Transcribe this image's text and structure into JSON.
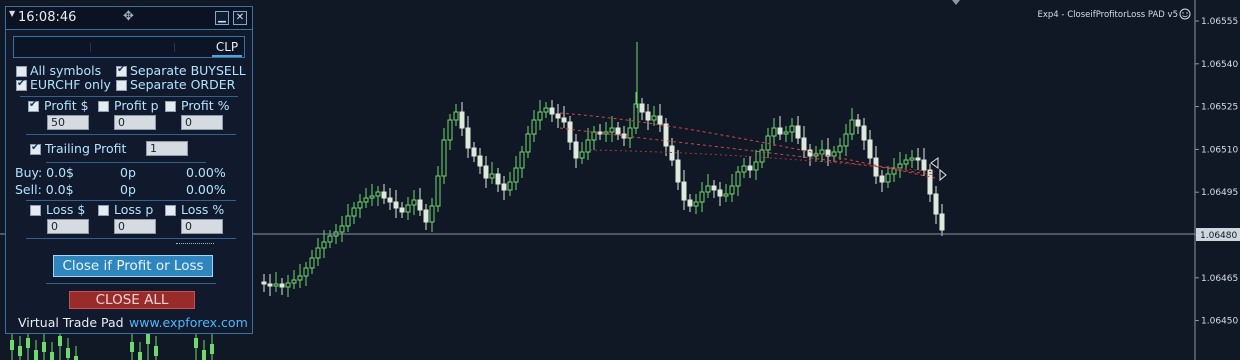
{
  "chart": {
    "title": "Exp4 - CloseifProfitorLoss PAD v5",
    "title_icon": "smiley-icon",
    "price_labels": [
      "1.06555",
      "1.06540",
      "1.06525",
      "1.06510",
      "1.06495",
      "1.06480",
      "1.06465",
      "1.06450"
    ],
    "current_price": "1.06480",
    "bull_color": "#6fd86f",
    "bear_color": "#dfe8dc",
    "background": "#101725"
  },
  "panel": {
    "time": "16:08:46",
    "move_icon": "move-icon",
    "minimize_icon": "minimize-icon",
    "close_icon": "close-icon",
    "tab_clp": "CLP",
    "all_symbols": "All symbols",
    "separate_buysell": "Separate BUYSELL",
    "eurchf_only": "EURCHF only",
    "separate_order": "Separate ORDER",
    "profit_usd": "Profit $",
    "profit_p": "Profit p",
    "profit_pct": "Profit %",
    "profit_usd_value": "50",
    "profit_p_value": "0",
    "profit_pct_value": "0",
    "trailing_profit": "Trailing Profit",
    "trailing_value": "1",
    "buy_label": "Buy: 0.0$",
    "buy_p": "0p",
    "buy_pct": "0.00%",
    "sell_label": "Sell: 0.0$",
    "sell_p": "0p",
    "sell_pct": "0.00%",
    "loss_usd": "Loss $",
    "loss_p": "Loss p",
    "loss_pct": "Loss %",
    "loss_usd_value": "0",
    "loss_p_value": "0",
    "loss_pct_value": "0",
    "close_if_button": "Close if Profit or Loss",
    "close_all_button": "CLOSE ALL",
    "footer_left": "Virtual Trade Pad",
    "footer_right": "www.expforex.com",
    "checked": {
      "all_symbols": false,
      "separate_buysell": true,
      "eurchf_only": true,
      "separate_order": false,
      "profit_usd": true,
      "profit_p": false,
      "profit_pct": false,
      "trailing_profit": true,
      "loss_usd": false,
      "loss_p": false,
      "loss_pct": false
    }
  }
}
